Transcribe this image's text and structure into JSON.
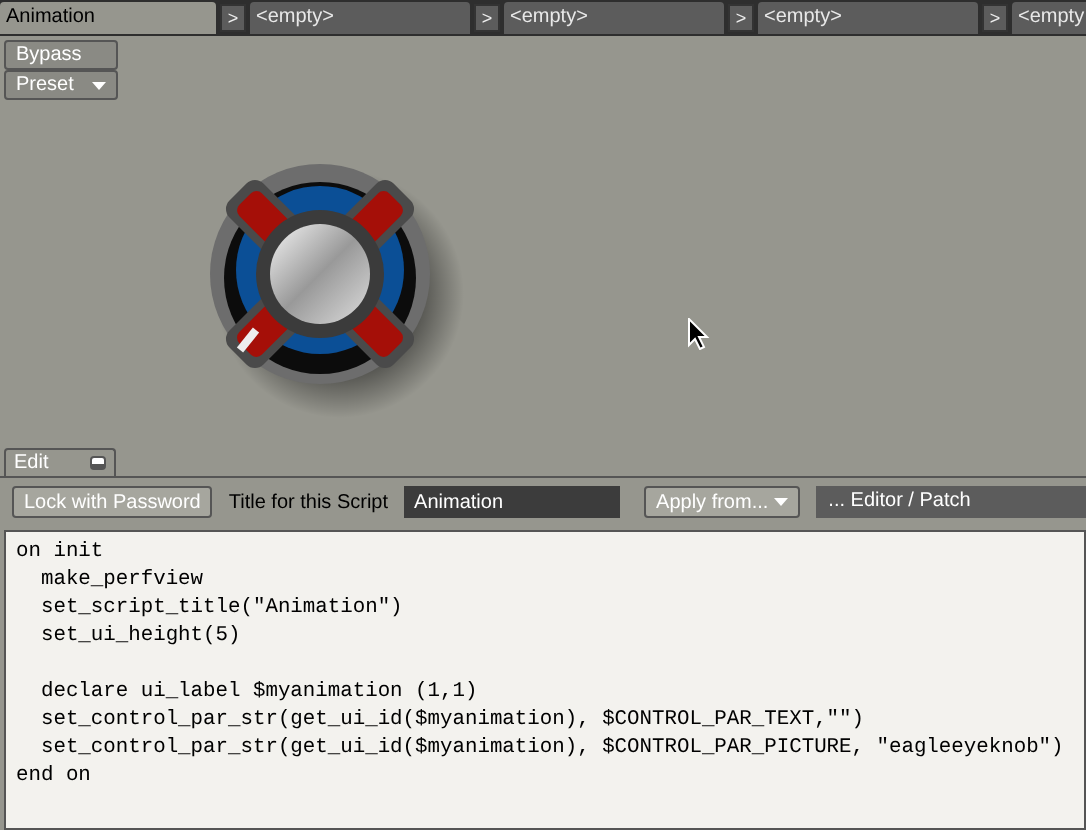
{
  "slots": [
    {
      "label": "Animation",
      "selected": true
    },
    {
      "label": "<empty>",
      "selected": false
    },
    {
      "label": "<empty>",
      "selected": false
    },
    {
      "label": "<empty>",
      "selected": false
    },
    {
      "label": "<empty",
      "selected": false
    }
  ],
  "slot_arrow": ">",
  "perf_buttons": [
    {
      "label": "Bypass",
      "kind": "button"
    },
    {
      "label": "Preset",
      "kind": "dropdown"
    }
  ],
  "edit_tab": {
    "label": "Edit",
    "selected": true
  },
  "toolbar": {
    "lock_button": "Lock with Password",
    "title_label": "Title for this Script",
    "title_value": "Animation",
    "apply_button": "Apply from...",
    "source": "... Editor / Patch"
  },
  "code": {
    "blocks": [
      [
        "on init",
        "  make_perfview",
        "  set_script_title(\"Animation\")",
        "  set_ui_height(5)"
      ],
      [
        "  declare ui_label $myanimation (1,1)",
        "  set_control_par_str(get_ui_id($myanimation), $CONTROL_PAR_TEXT,\"\")",
        "  set_control_par_str(get_ui_id($myanimation), $CONTROL_PAR_PICTURE, \"eagleeyeknob\")",
        "end on"
      ]
    ]
  }
}
